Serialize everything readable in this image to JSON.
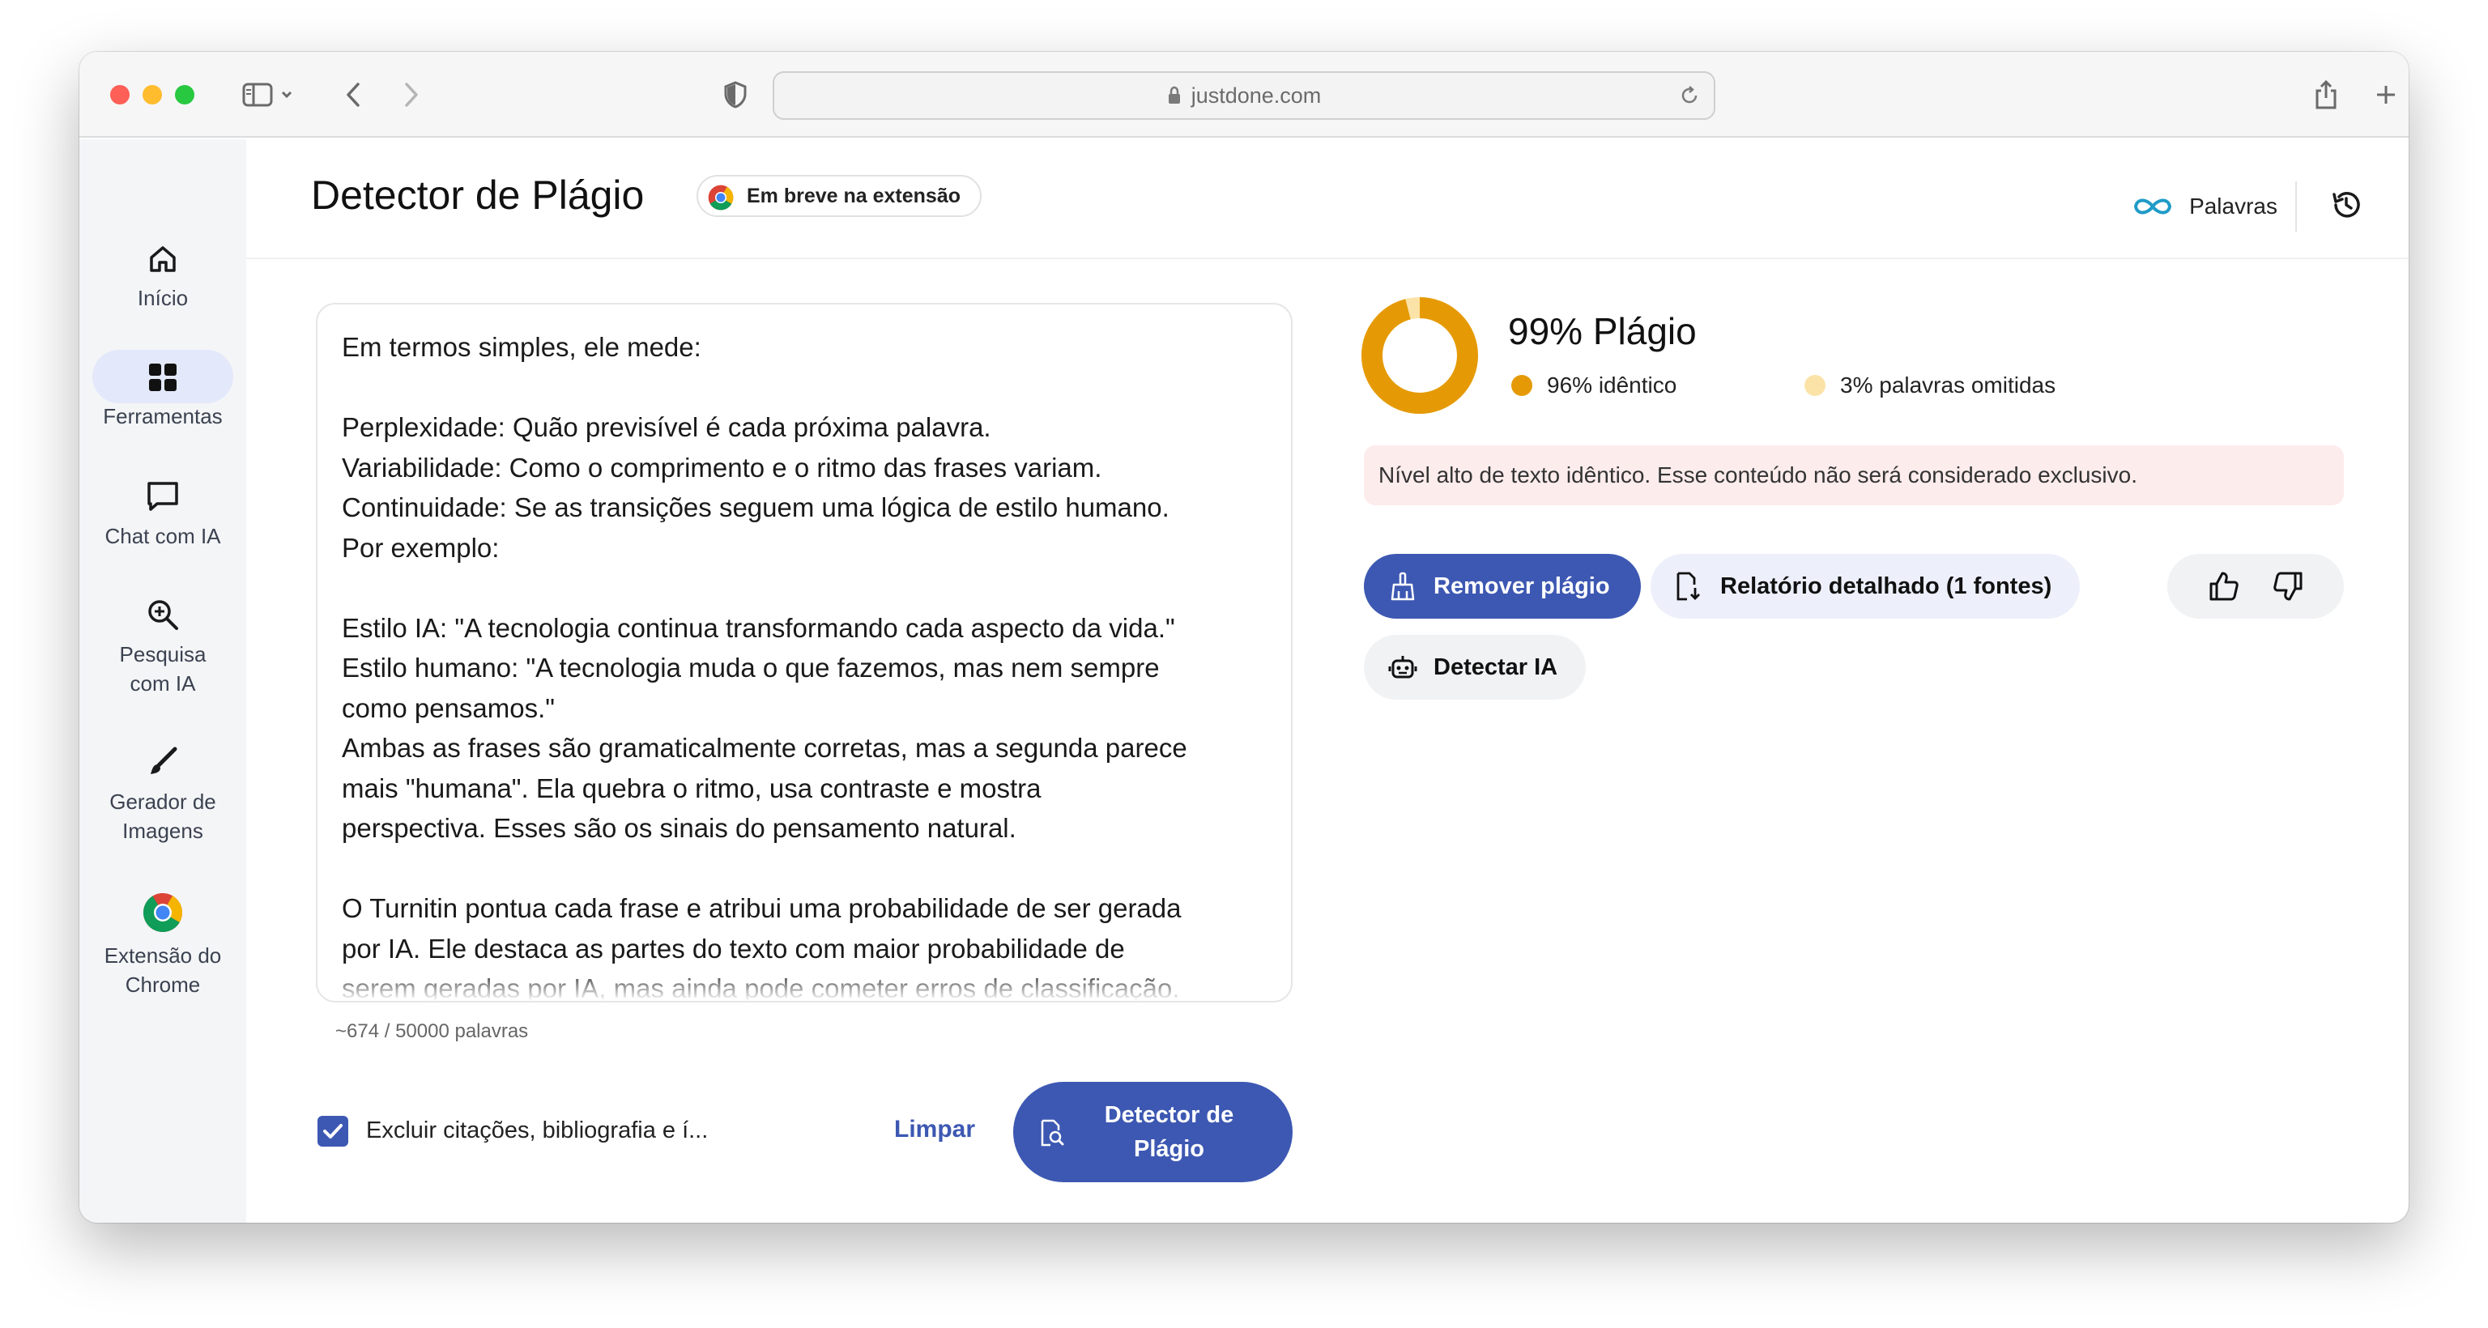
{
  "browser": {
    "url": "justdone.com"
  },
  "sidebar": {
    "items": [
      {
        "label": "Início",
        "icon": "home-icon"
      },
      {
        "label": "Ferramentas",
        "icon": "grid-icon",
        "active": true
      },
      {
        "label": "Chat com IA",
        "icon": "chat-icon"
      },
      {
        "label": "Pesquisa com IA",
        "icon": "search-icon"
      },
      {
        "label": "Gerador de Imagens",
        "icon": "brush-icon"
      },
      {
        "label": "Extensão do Chrome",
        "icon": "chrome-icon"
      }
    ]
  },
  "header": {
    "title": "Detector de Plágio",
    "badge": "Em breve na extensão",
    "words_label": "Palavras",
    "words_icon": "infinity-icon"
  },
  "editor": {
    "paragraphs": [
      "Em termos simples, ele mede:",
      "",
      "Perplexidade: Quão previsível é cada próxima palavra.",
      "Variabilidade: Como o comprimento e o ritmo das frases variam.",
      "Continuidade: Se as transições seguem uma lógica de estilo humano.",
      "Por exemplo:",
      "",
      "Estilo IA: \"A tecnologia continua transformando cada aspecto da vida.\"",
      "Estilo humano: \"A tecnologia muda o que fazemos, mas nem sempre",
      "como pensamos.\"",
      "Ambas as frases são gramaticalmente corretas, mas a segunda parece",
      "mais \"humana\". Ela quebra o ritmo, usa contraste e mostra",
      "perspectiva. Esses são os sinais do pensamento natural.",
      "",
      "O Turnitin pontua cada frase e atribui uma probabilidade de ser gerada",
      "por IA. Ele destaca as partes do texto com maior probabilidade de",
      "serem geradas por IA, mas ainda pode cometer erros de classificação."
    ],
    "word_count": "~674 / 50000 palavras",
    "exclude_label": "Excluir citações, bibliografia e í...",
    "exclude_checked": true,
    "clear_label": "Limpar",
    "detect_label": "Detector de Plágio"
  },
  "result": {
    "score_label": "99% Plágio",
    "identical_pct": 96,
    "omitted_pct": 3,
    "identical_label": "96% idêntico",
    "omitted_label": "3% palavras omitidas",
    "alert": "Nível alto de texto idêntico. Esse conteúdo não será considerado exclusivo.",
    "remove_label": "Remover plágio",
    "report_label": "Relatório detalhado (1 fontes)",
    "detect_ai_label": "Detectar IA"
  },
  "colors": {
    "accent": "#3d58b2",
    "identical": "#e59a05",
    "omitted": "#fbe3a8",
    "alert_bg": "#fdecec",
    "active_nav_bg": "#e3e8fb"
  }
}
